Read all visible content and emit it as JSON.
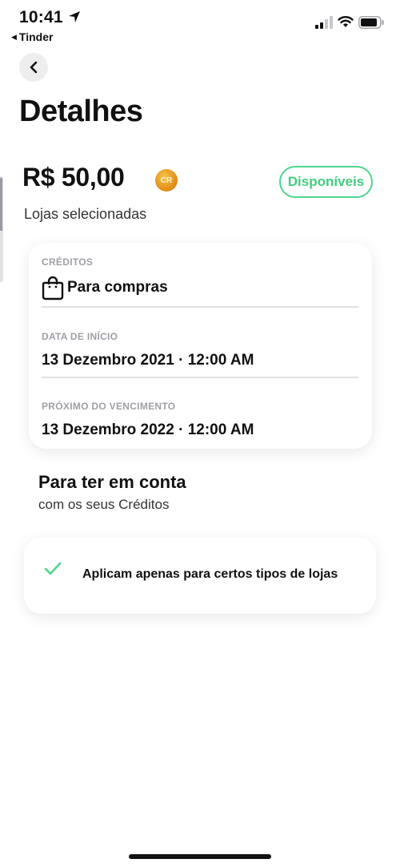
{
  "status_bar": {
    "time": "10:41",
    "back_app": "Tinder"
  },
  "header": {
    "title": "Detalhes"
  },
  "summary": {
    "amount": "R$ 50,00",
    "coin_label": "CR",
    "status_badge": "Disponíveis",
    "subtitle": "Lojas selecionadas"
  },
  "details": {
    "credits_label": "CRÉDITOS",
    "credits_value": "Para compras",
    "start_label": "DATA DE INÍCIO",
    "start_value": "13 Dezembro 2021 · 12:00 AM",
    "expiry_label": "PRÓXIMO DO VENCIMENTO",
    "expiry_value": "13 Dezembro 2022 · 12:00 AM"
  },
  "notes": {
    "title": "Para ter em conta",
    "subtitle": "com os seus Créditos",
    "rules": [
      "Aplicam apenas para certos tipos de lojas"
    ]
  },
  "colors": {
    "accent_green": "#3fcf7f",
    "coin": "#e08a14"
  },
  "icons": [
    "location-arrow-icon",
    "signal-icon",
    "wifi-icon",
    "battery-icon",
    "chevron-left-icon",
    "coin-icon",
    "shopping-bag-icon",
    "check-icon"
  ]
}
